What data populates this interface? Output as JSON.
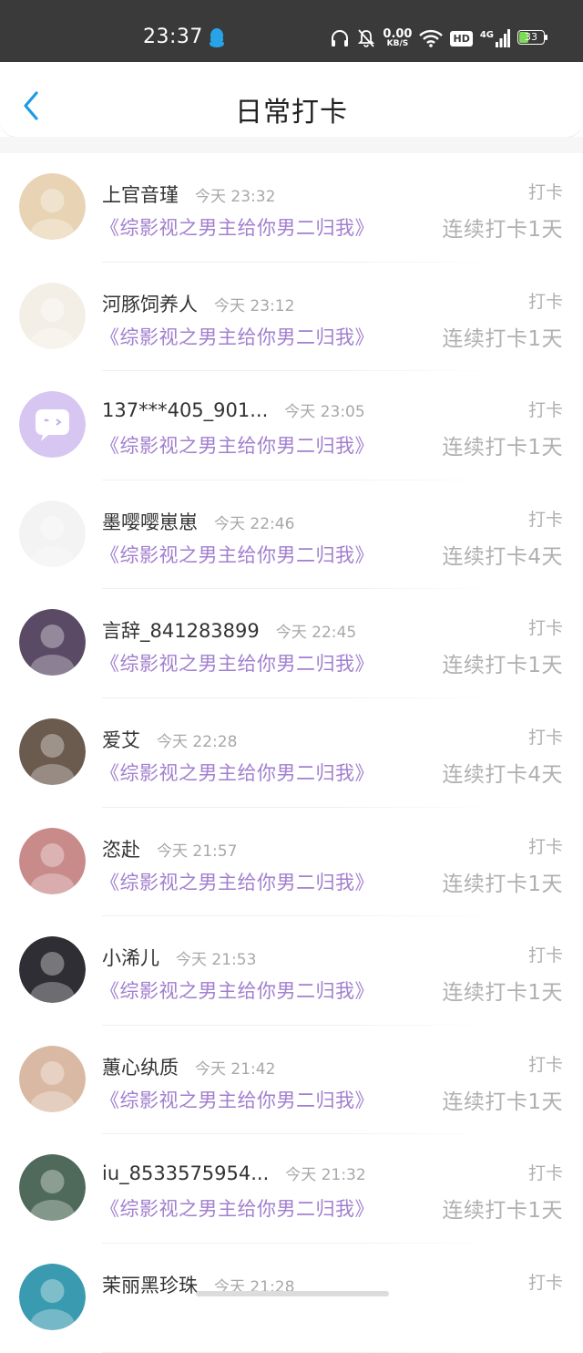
{
  "status_bar": {
    "time": "23:37",
    "net_speed_value": "0.00",
    "net_speed_unit": "KB/S",
    "hd_label": "HD",
    "signal_label": "4G",
    "battery_level": "33"
  },
  "header": {
    "title": "日常打卡"
  },
  "checkins": [
    {
      "name": "上官音瑾",
      "time": "今天 23:32",
      "book": "《综影视之男主给你男二归我》",
      "tag": "打卡",
      "streak": "连续打卡1天",
      "avatar_color": "#e8d4b4"
    },
    {
      "name": "河豚饲养人",
      "time": "今天 23:12",
      "book": "《综影视之男主给你男二归我》",
      "tag": "打卡",
      "streak": "连续打卡1天",
      "avatar_color": "#f4efe6"
    },
    {
      "name": "137***405_901...",
      "time": "今天 23:05",
      "book": "《综影视之男主给你男二归我》",
      "tag": "打卡",
      "streak": "连续打卡1天",
      "avatar_color": "#d8c6f2"
    },
    {
      "name": "墨嘤嘤崽崽",
      "time": "今天 22:46",
      "book": "《综影视之男主给你男二归我》",
      "tag": "打卡",
      "streak": "连续打卡4天",
      "avatar_color": "#f3f3f3"
    },
    {
      "name": "言辞_841283899",
      "time": "今天 22:45",
      "book": "《综影视之男主给你男二归我》",
      "tag": "打卡",
      "streak": "连续打卡1天",
      "avatar_color": "#5a4a66"
    },
    {
      "name": "爱艾",
      "time": "今天 22:28",
      "book": "《综影视之男主给你男二归我》",
      "tag": "打卡",
      "streak": "连续打卡4天",
      "avatar_color": "#6b5a4e"
    },
    {
      "name": "恣赴",
      "time": "今天 21:57",
      "book": "《综影视之男主给你男二归我》",
      "tag": "打卡",
      "streak": "连续打卡1天",
      "avatar_color": "#c98a8a"
    },
    {
      "name": "小浠儿",
      "time": "今天 21:53",
      "book": "《综影视之男主给你男二归我》",
      "tag": "打卡",
      "streak": "连续打卡1天",
      "avatar_color": "#2e2e34"
    },
    {
      "name": "蕙心纨质",
      "time": "今天 21:42",
      "book": "《综影视之男主给你男二归我》",
      "tag": "打卡",
      "streak": "连续打卡1天",
      "avatar_color": "#d9b9a4"
    },
    {
      "name": "iu_8533575954...",
      "time": "今天 21:32",
      "book": "《综影视之男主给你男二归我》",
      "tag": "打卡",
      "streak": "连续打卡1天",
      "avatar_color": "#4f6a5a"
    },
    {
      "name": "茉丽黑珍珠",
      "time": "今天 21:28",
      "book": "",
      "tag": "打卡",
      "streak": "",
      "avatar_color": "#3a9bb0"
    }
  ]
}
